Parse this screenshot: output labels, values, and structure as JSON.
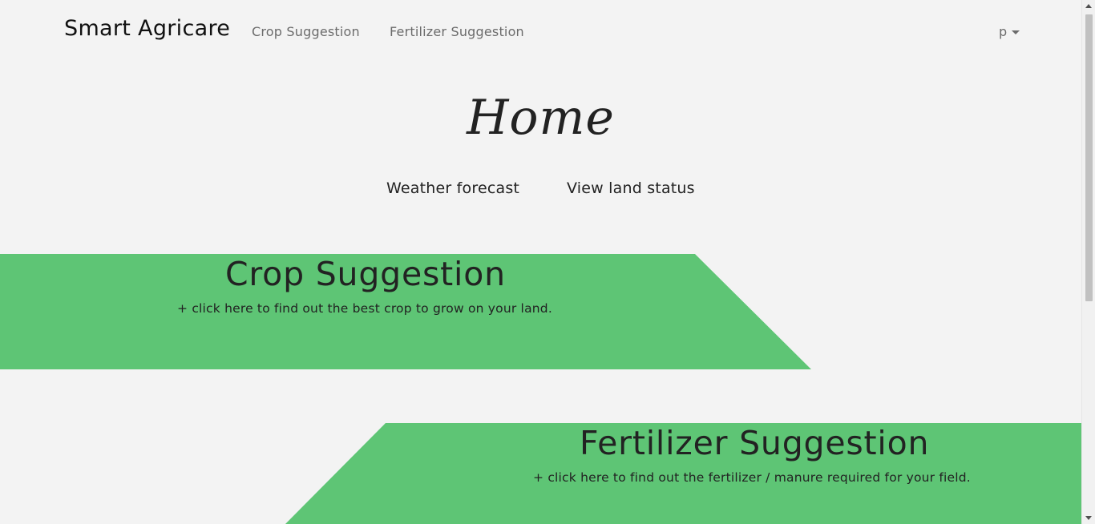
{
  "navbar": {
    "brand": "Smart Agricare",
    "links": [
      "Crop Suggestion",
      "Fertilizer Suggestion"
    ],
    "user_label": "p"
  },
  "main": {
    "title": "Home",
    "sub_links": {
      "weather": "Weather forecast",
      "land": "View land status"
    }
  },
  "cards": {
    "crop": {
      "title": "Crop Suggestion",
      "description": "+ click here to find out the best crop to grow on your land."
    },
    "fertilizer": {
      "title": "Fertilizer Suggestion",
      "description": "+ click here to find out the fertilizer / manure required for your field."
    }
  },
  "colors": {
    "background": "#f3f3f3",
    "panel_green": "#5ec575",
    "text_dark": "#222222",
    "nav_text": "#6b6b6b"
  },
  "icons": {
    "user_dropdown": "caret-down-icon"
  }
}
